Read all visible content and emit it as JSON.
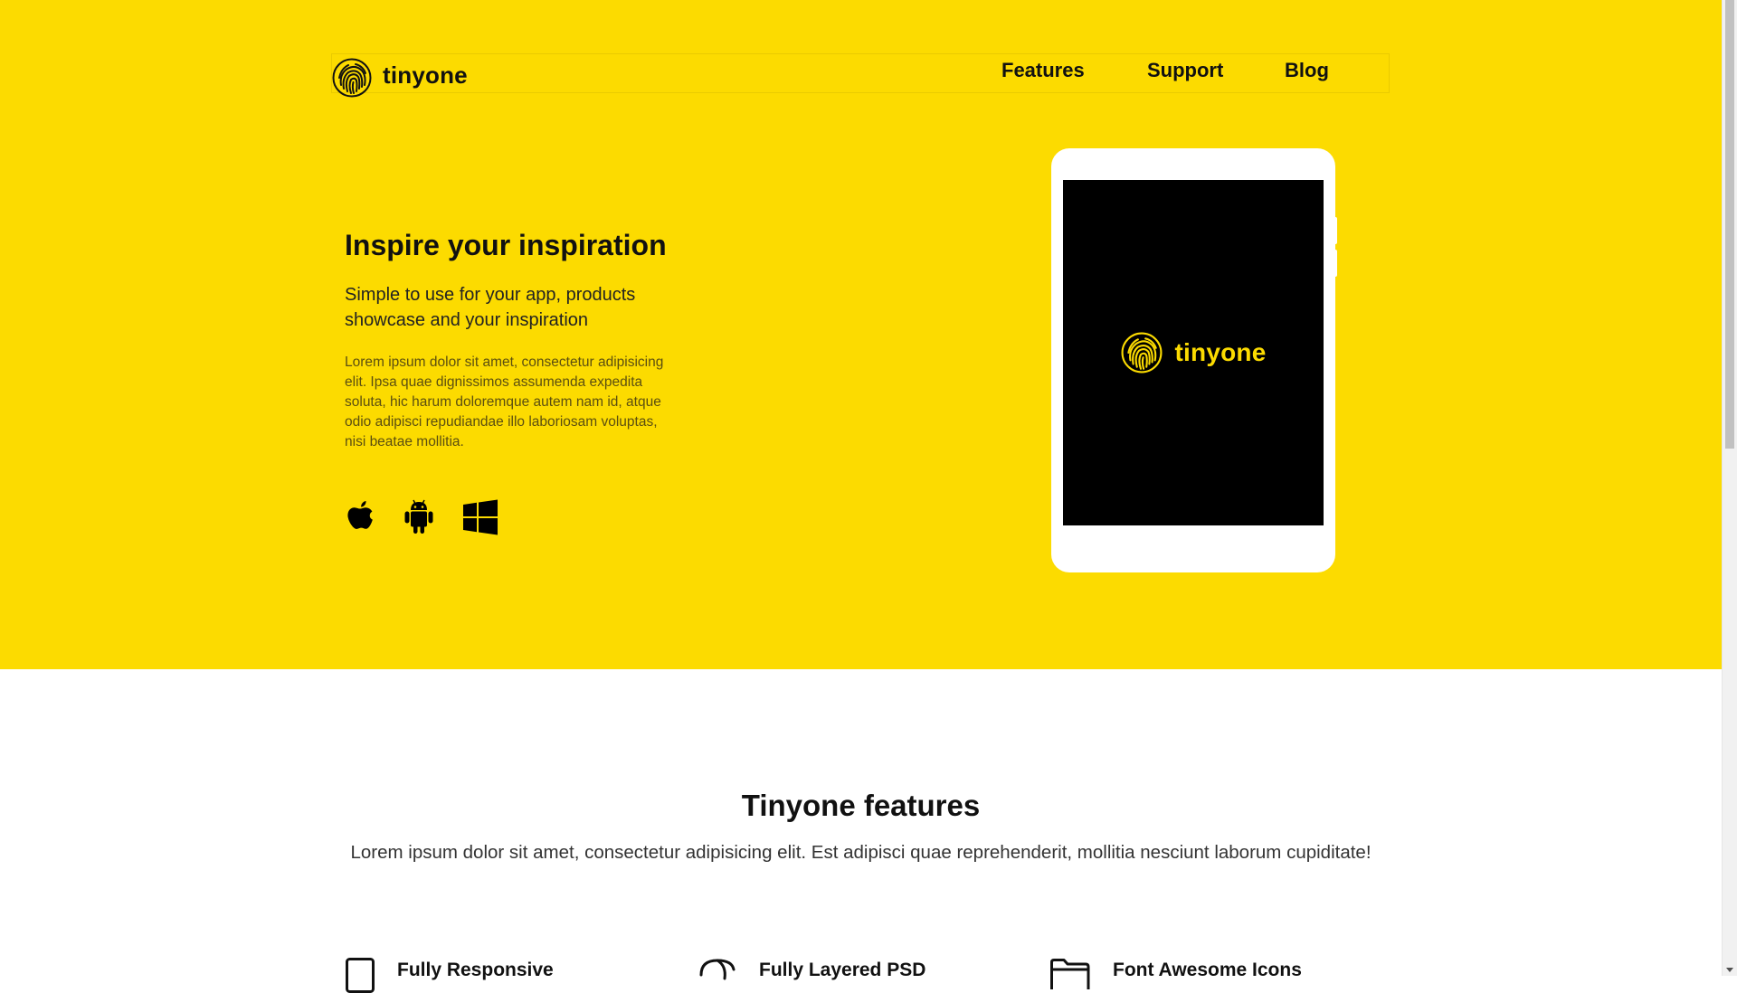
{
  "brand": {
    "name": "tinyone",
    "icon": "fingerprint-icon"
  },
  "nav": {
    "items": [
      {
        "label": "Features"
      },
      {
        "label": "Support"
      },
      {
        "label": "Blog"
      }
    ]
  },
  "hero": {
    "title": "Inspire your inspiration",
    "subtitle": "Simple to use for your app, products showcase and your inspiration",
    "paragraph": "Lorem ipsum dolor sit amet, consectetur adipisicing elit. Ipsa quae dignissimos assumenda expedita soluta, hic harum doloremque autem nam id, atque odio adipisci repudiandae illo laboriosam voluptas, nisi beatae mollitia.",
    "platforms": [
      {
        "icon": "apple-icon"
      },
      {
        "icon": "android-icon"
      },
      {
        "icon": "windows-icon"
      }
    ],
    "device_screen": {
      "brand_name": "tinyone",
      "icon": "fingerprint-icon"
    },
    "colors": {
      "background": "#fcdb00",
      "accent": "#fcdb00",
      "text": "#111111"
    }
  },
  "features": {
    "title": "Tinyone features",
    "subtitle": "Lorem ipsum dolor sit amet, consectetur adipisicing elit. Est adipisci quae reprehenderit, mollitia nesciunt laborum cupiditate!",
    "items": [
      {
        "title": "Fully Responsive",
        "icon": "tablet-icon"
      },
      {
        "title": "Fully Layered PSD",
        "icon": "layers-icon"
      },
      {
        "title": "Font Awesome Icons",
        "icon": "folder-icon"
      }
    ]
  }
}
